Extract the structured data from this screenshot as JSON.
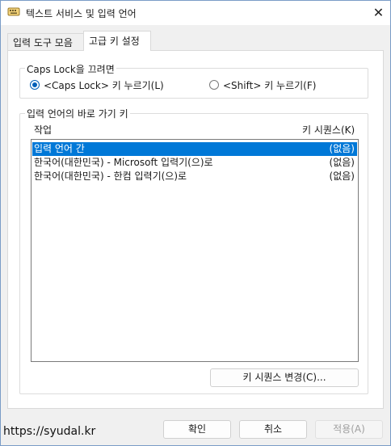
{
  "window": {
    "title": "텍스트 서비스 및 입력 언어",
    "close_symbol": "✕",
    "app_icon": "keyboard-icon"
  },
  "tabs": [
    {
      "label": "입력 도구 모음",
      "selected": false
    },
    {
      "label": "고급 키 설정",
      "selected": true
    }
  ],
  "caps_lock": {
    "legend": "Caps Lock을 끄려면",
    "options": [
      {
        "label": "<Caps Lock> 키 누르기(L)",
        "selected": true
      },
      {
        "label": "<Shift> 키 누르기(F)",
        "selected": false
      }
    ]
  },
  "hotkeys": {
    "legend": "입력 언어의 바로 가기 키",
    "col_action": "작업",
    "col_sequence": "키 시퀀스(K)",
    "rows": [
      {
        "action": "입력 언어 간",
        "sequence": "(없음)",
        "selected": true
      },
      {
        "action": "한국어(대한민국) - Microsoft 입력기(으)로",
        "sequence": "(없음)",
        "selected": false
      },
      {
        "action": "한국어(대한민국) - 한컴 입력기(으)로",
        "sequence": "(없음)",
        "selected": false
      }
    ],
    "change_button": "키 시퀀스 변경(C)..."
  },
  "footer": {
    "ok": "확인",
    "cancel": "취소",
    "apply": "적용(A)",
    "apply_enabled": false
  },
  "watermark": "https://syudal.kr",
  "colors": {
    "selection": "#0078d7",
    "radio_accent": "#005fb8"
  }
}
